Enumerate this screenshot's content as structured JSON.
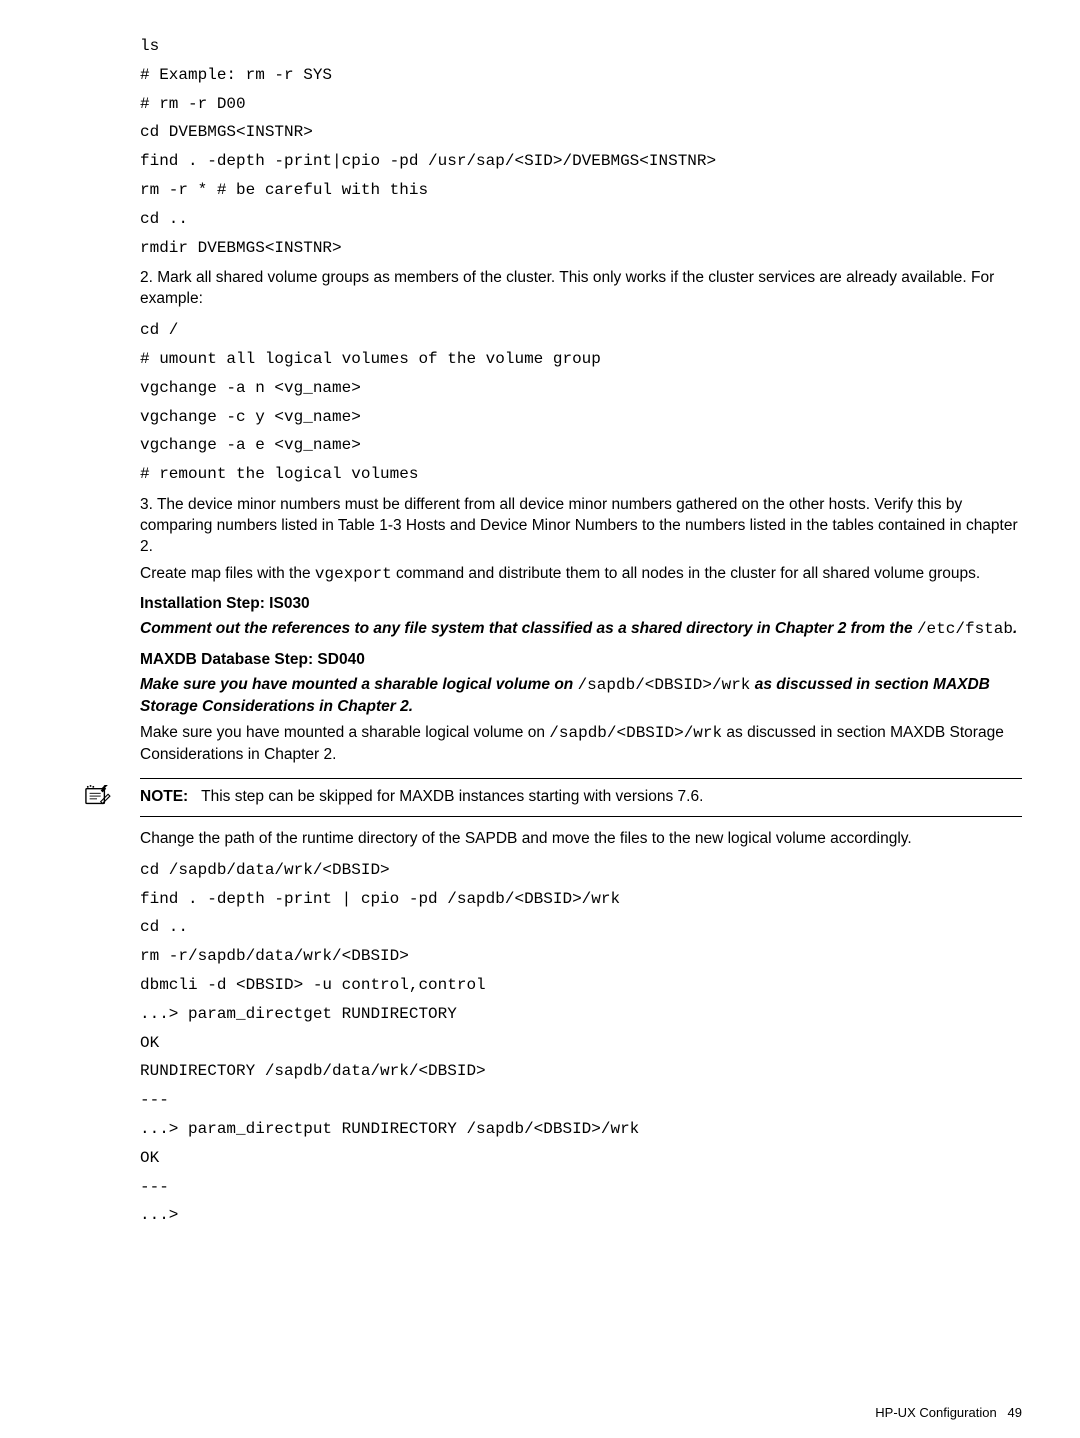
{
  "code1": "ls\n# Example: rm -r SYS\n# rm -r D00\ncd DVEBMGS<INSTNR>\nfind . -depth -print|cpio -pd /usr/sap/<SID>/DVEBMGS<INSTNR>\nrm -r * # be careful with this\ncd ..\nrmdir DVEBMGS<INSTNR>",
  "p1": "2. Mark all shared volume groups as members of the cluster. This only works if the cluster services are already available. For example:",
  "code2": "cd /\n# umount all logical volumes of the volume group\nvgchange -a n <vg_name>\nvgchange -c y <vg_name>\nvgchange -a e <vg_name>\n# remount the logical volumes",
  "p2": "3. The device minor numbers must be different from all device minor numbers gathered on the other hosts. Verify this by comparing numbers listed in Table 1-3 Hosts and Device Minor Numbers to the numbers listed in the tables contained in chapter 2.",
  "p3_a": "Create map files with the ",
  "p3_code": "vgexport",
  "p3_b": " command and distribute them to all nodes in the cluster for all shared volume groups.",
  "step_is030": "Installation Step: IS030",
  "p4_a": "Comment out the references to any file system that classified as a shared directory in Chapter 2 from the ",
  "p4_code": "/etc/fstab",
  "p4_b": ".",
  "step_sd040": "MAXDB Database Step: SD040",
  "p5_a": "Make sure you have mounted a sharable logical volume on ",
  "p5_code": "/sapdb/<DBSID>/wrk",
  "p5_b": " as discussed in section MAXDB Storage Considerations in Chapter 2.",
  "p6_a": "Make sure you have mounted a sharable logical volume on ",
  "p6_code": "/sapdb/<DBSID>/wrk",
  "p6_b": " as discussed in section MAXDB Storage Considerations in Chapter 2.",
  "note_label": "NOTE:",
  "note_text": "This step can be skipped for MAXDB instances starting with versions 7.6.",
  "p7": "Change the path of the runtime directory of the SAPDB and move the files to the new logical volume accordingly.",
  "code3": "cd /sapdb/data/wrk/<DBSID>\nfind . -depth -print | cpio -pd /sapdb/<DBSID>/wrk\ncd ..\nrm -r/sapdb/data/wrk/<DBSID>\ndbmcli -d <DBSID> -u control,control\n...> param_directget RUNDIRECTORY\nOK\nRUNDIRECTORY /sapdb/data/wrk/<DBSID>\n---\n...> param_directput RUNDIRECTORY /sapdb/<DBSID>/wrk\nOK\n---\n...>",
  "footer_text": "HP-UX Configuration",
  "footer_page": "49"
}
